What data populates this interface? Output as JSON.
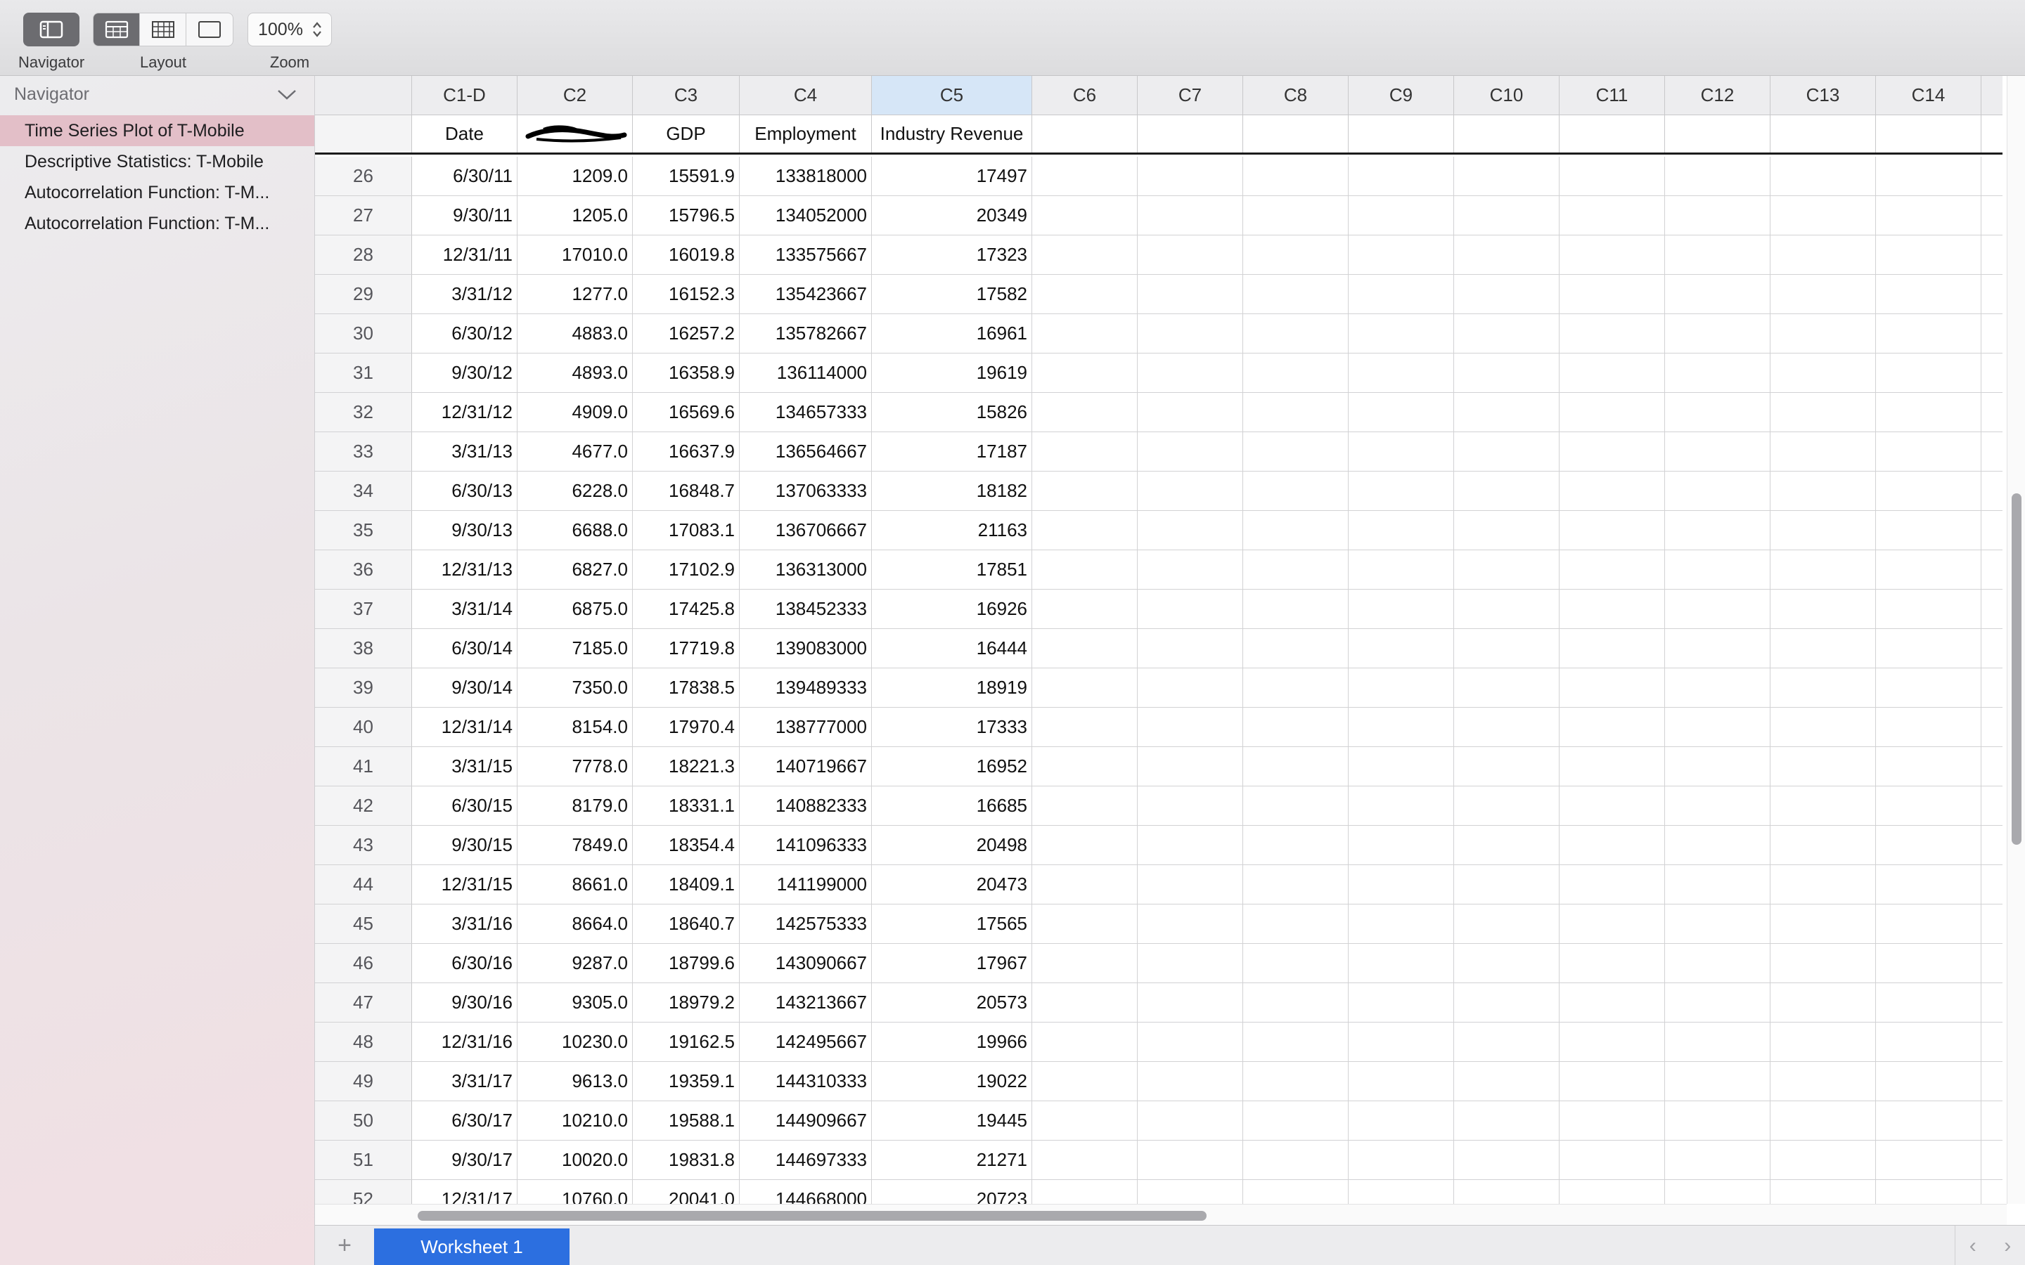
{
  "toolbar": {
    "navigator_label": "Navigator",
    "layout_label": "Layout",
    "zoom_label": "Zoom",
    "zoom_value": "100%"
  },
  "sidebar": {
    "title": "Navigator",
    "items": [
      {
        "label": "Time Series Plot of T-Mobile",
        "selected": true
      },
      {
        "label": "Descriptive Statistics: T-Mobile",
        "selected": false
      },
      {
        "label": "Autocorrelation Function: T-M...",
        "selected": false
      },
      {
        "label": "Autocorrelation Function: T-M...",
        "selected": false
      }
    ]
  },
  "grid": {
    "columns": [
      "C1-D",
      "C2",
      "C3",
      "C4",
      "C5",
      "C6",
      "C7",
      "C8",
      "C9",
      "C10",
      "C11",
      "C12",
      "C13",
      "C14"
    ],
    "selected_column": "C5",
    "names": [
      "Date",
      "",
      "GDP",
      "Employment",
      "Industry Revenue"
    ],
    "rows": [
      [
        "26",
        "6/30/11",
        "1209.0",
        "15591.9",
        "133818000",
        "17497"
      ],
      [
        "27",
        "9/30/11",
        "1205.0",
        "15796.5",
        "134052000",
        "20349"
      ],
      [
        "28",
        "12/31/11",
        "17010.0",
        "16019.8",
        "133575667",
        "17323"
      ],
      [
        "29",
        "3/31/12",
        "1277.0",
        "16152.3",
        "135423667",
        "17582"
      ],
      [
        "30",
        "6/30/12",
        "4883.0",
        "16257.2",
        "135782667",
        "16961"
      ],
      [
        "31",
        "9/30/12",
        "4893.0",
        "16358.9",
        "136114000",
        "19619"
      ],
      [
        "32",
        "12/31/12",
        "4909.0",
        "16569.6",
        "134657333",
        "15826"
      ],
      [
        "33",
        "3/31/13",
        "4677.0",
        "16637.9",
        "136564667",
        "17187"
      ],
      [
        "34",
        "6/30/13",
        "6228.0",
        "16848.7",
        "137063333",
        "18182"
      ],
      [
        "35",
        "9/30/13",
        "6688.0",
        "17083.1",
        "136706667",
        "21163"
      ],
      [
        "36",
        "12/31/13",
        "6827.0",
        "17102.9",
        "136313000",
        "17851"
      ],
      [
        "37",
        "3/31/14",
        "6875.0",
        "17425.8",
        "138452333",
        "16926"
      ],
      [
        "38",
        "6/30/14",
        "7185.0",
        "17719.8",
        "139083000",
        "16444"
      ],
      [
        "39",
        "9/30/14",
        "7350.0",
        "17838.5",
        "139489333",
        "18919"
      ],
      [
        "40",
        "12/31/14",
        "8154.0",
        "17970.4",
        "138777000",
        "17333"
      ],
      [
        "41",
        "3/31/15",
        "7778.0",
        "18221.3",
        "140719667",
        "16952"
      ],
      [
        "42",
        "6/30/15",
        "8179.0",
        "18331.1",
        "140882333",
        "16685"
      ],
      [
        "43",
        "9/30/15",
        "7849.0",
        "18354.4",
        "141096333",
        "20498"
      ],
      [
        "44",
        "12/31/15",
        "8661.0",
        "18409.1",
        "141199000",
        "20473"
      ],
      [
        "45",
        "3/31/16",
        "8664.0",
        "18640.7",
        "142575333",
        "17565"
      ],
      [
        "46",
        "6/30/16",
        "9287.0",
        "18799.6",
        "143090667",
        "17967"
      ],
      [
        "47",
        "9/30/16",
        "9305.0",
        "18979.2",
        "143213667",
        "20573"
      ],
      [
        "48",
        "12/31/16",
        "10230.0",
        "19162.5",
        "142495667",
        "19966"
      ],
      [
        "49",
        "3/31/17",
        "9613.0",
        "19359.1",
        "144310333",
        "19022"
      ],
      [
        "50",
        "6/30/17",
        "10210.0",
        "19588.1",
        "144909667",
        "19445"
      ],
      [
        "51",
        "9/30/17",
        "10020.0",
        "19831.8",
        "144697333",
        "21271"
      ],
      [
        "52",
        "12/31/17",
        "10760.0",
        "20041.0",
        "144668000",
        "20723"
      ]
    ]
  },
  "tabs": {
    "add_label": "+",
    "sheets": [
      "Worksheet 1"
    ],
    "prev_glyph": "‹",
    "next_glyph": "›"
  },
  "colors": {
    "selected_sidebar": "#e3bfc8",
    "selected_column_header": "#d6e6f7",
    "active_sheet_tab": "#2c6fe0"
  }
}
